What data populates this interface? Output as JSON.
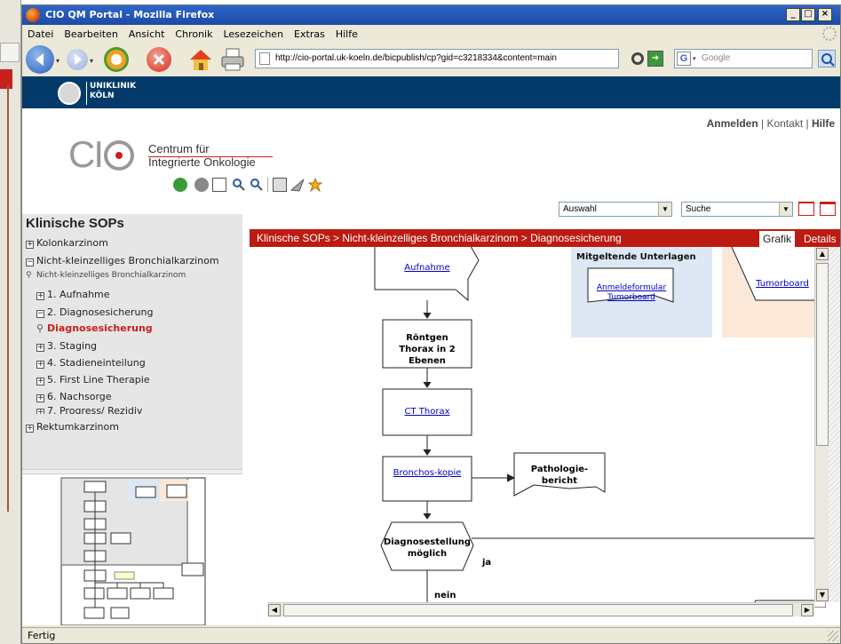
{
  "window": {
    "title": "CIO QM Portal - Mozilla Firefox"
  },
  "menu": [
    "Datei",
    "Bearbeiten",
    "Ansicht",
    "Chronik",
    "Lesezeichen",
    "Extras",
    "Hilfe"
  ],
  "nav": {
    "url": "http://cio-portal.uk-koeln.de/bicpublish/cp?gid=c3218334&content=main",
    "search_placeholder": "Google"
  },
  "header": {
    "logo_line1": "UNIKLINIK",
    "logo_line2": "KÖLN"
  },
  "toplinks": {
    "login": "Anmelden",
    "sep1": "|",
    "contact": "Kontakt",
    "sep2": "|",
    "help": "Hilfe"
  },
  "cio": {
    "mark": "CI",
    "line1": "Centrum für",
    "line2": "Integrierte Onkologie"
  },
  "selects": {
    "select1": "Auswahl",
    "select2": "Suche"
  },
  "sidebar": {
    "title": "Klinische SOPs",
    "items": [
      {
        "label": "Kolonkarzinom",
        "toggle": "+"
      },
      {
        "label": "Nicht-kleinzelliges Bronchialkarzinom",
        "toggle": "−"
      },
      {
        "label": "Nicht-kleinzelliges Bronchialkarzinom"
      },
      {
        "label": "1. Aufnahme",
        "toggle": "+"
      },
      {
        "label": "2. Diagnosesicherung",
        "toggle": "−"
      },
      {
        "label": "Diagnosesicherung"
      },
      {
        "label": "3. Staging",
        "toggle": "+"
      },
      {
        "label": "4. Stadieneinteilung",
        "toggle": "+"
      },
      {
        "label": "5. First Line Therapie",
        "toggle": "+"
      },
      {
        "label": "6. Nachsorge",
        "toggle": "+"
      },
      {
        "label": "7. Progress/ Rezidiv",
        "toggle": "+"
      },
      {
        "label": "Rektumkarzinom",
        "toggle": "+"
      }
    ]
  },
  "breadcrumb": "Klinische SOPs > Nicht-kleinzelliges Bronchialkarzinom > Diagnosesicherung",
  "tabs": {
    "grafik": "Grafik",
    "details": "Details"
  },
  "diagram": {
    "aufnahme": "Aufnahme",
    "mitgeltende_title": "Mitgeltende Unterlagen",
    "anmeldeformular": "Anmeldeformular Tumorboard",
    "tumorboard": "Tumorboard",
    "roentgen": "Röntgen Thorax in 2 Ebenen",
    "ct": "CT Thorax",
    "bronchos": "Bronchos-kopie",
    "patho": "Pathologie-bericht",
    "diagnose": "Diagnosestellung möglich",
    "ja": "ja",
    "nein": "nein"
  },
  "status": {
    "text": "Fertig"
  },
  "colors": {
    "brand_red": "#bc1b12",
    "header_blue": "#033a6a",
    "title_blue": "#1c4aa6",
    "panel_blue": "#dde8f4",
    "panel_peach": "#fbe8d8"
  }
}
